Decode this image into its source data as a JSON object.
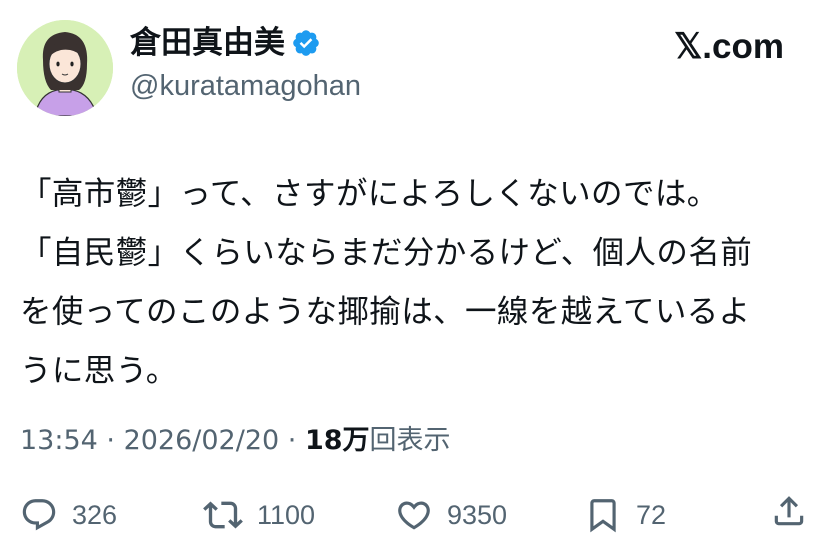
{
  "author": {
    "display_name": "倉田真由美",
    "handle": "@kuratamagohan",
    "verified_icon": "verified-badge-icon",
    "avatar": "illustrated-avatar"
  },
  "site_label": "𝕏.com",
  "tweet": {
    "lines": [
      "「高市鬱」って、さすがによろしくないのでは。",
      "「自民鬱」くらいならまだ分かるけど、個人の名前",
      "を使ってのこのような揶揄は、一線を越えているよ",
      "うに思う。"
    ]
  },
  "meta": {
    "time": "13:54",
    "sep1": " · ",
    "date": "2026/02/20",
    "sep2": " · ",
    "views": "18万",
    "views_suffix": "回表示"
  },
  "actions": {
    "reply": {
      "icon": "reply-icon",
      "count": "326"
    },
    "repost": {
      "icon": "repost-icon",
      "count": "1100"
    },
    "like": {
      "icon": "heart-icon",
      "count": "9350"
    },
    "bookmark": {
      "icon": "bookmark-icon",
      "count": "72"
    },
    "share": {
      "icon": "share-icon"
    }
  },
  "colors": {
    "text": "#0f1419",
    "secondary": "#536471",
    "verified": "#1d9bf0",
    "avatar_bg": "#d7f0b6"
  }
}
